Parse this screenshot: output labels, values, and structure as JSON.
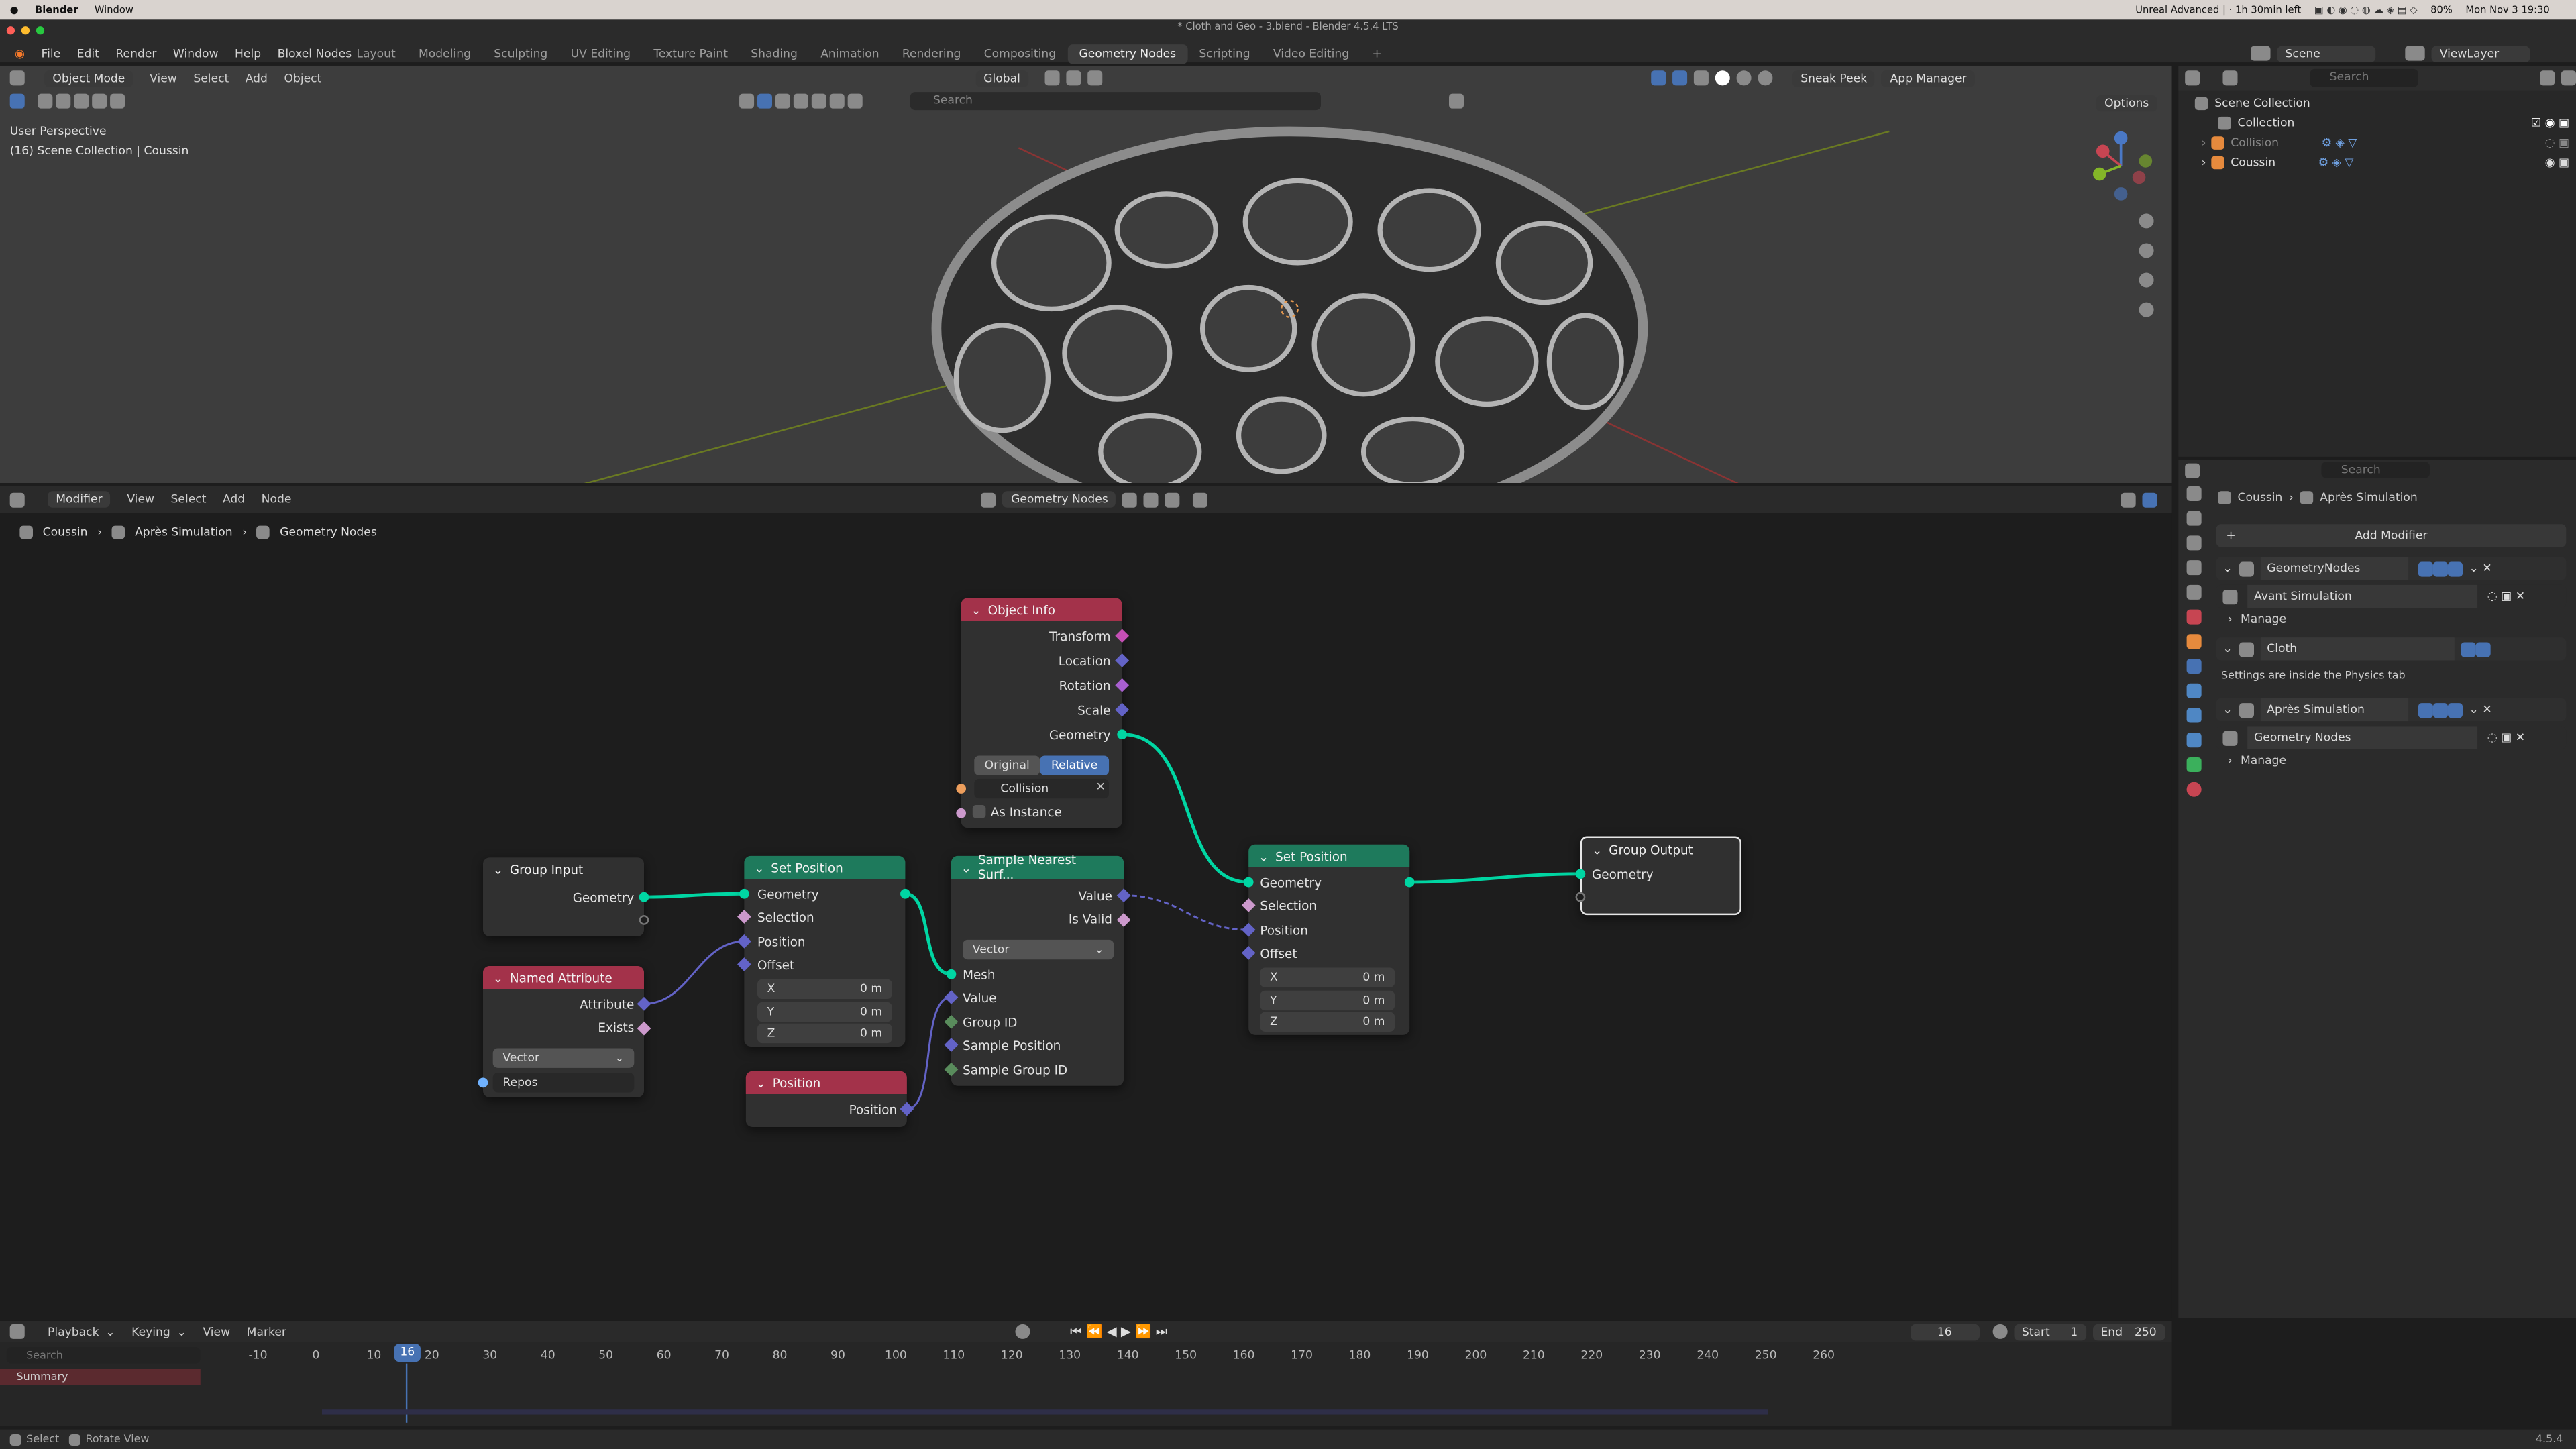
{
  "mac_menubar": {
    "app": "Blender",
    "window": "Window",
    "status": "Unreal Advanced | · 1h 30min left",
    "battery": "80%",
    "clock": "Mon Nov 3 19:30"
  },
  "window_title": "* Cloth and Geo - 3.blend - Blender 4.5.4 LTS",
  "menu": [
    "File",
    "Edit",
    "Render",
    "Window",
    "Help",
    "Bloxel Nodes"
  ],
  "workspaces": [
    "Layout",
    "Modeling",
    "Sculpting",
    "UV Editing",
    "Texture Paint",
    "Shading",
    "Animation",
    "Rendering",
    "Compositing",
    "Geometry Nodes",
    "Scripting",
    "Video Editing"
  ],
  "active_workspace": "Geometry Nodes",
  "viewport": {
    "mode": "Object Mode",
    "menus": [
      "View",
      "Select",
      "Add",
      "Object"
    ],
    "transform": "Global",
    "search_placeholder": "Search",
    "sneak_peek": "Sneak Peek",
    "app_manager": "App Manager",
    "options": "Options",
    "perspective": "User Perspective",
    "context": "(16) Scene Collection | Coussin"
  },
  "outliner": {
    "scene": "Scene",
    "view_layer": "ViewLayer",
    "search_placeholder": "Search",
    "root": "Scene Collection",
    "items": [
      "Collection",
      "Collision",
      "Coussin"
    ]
  },
  "node_editor": {
    "type": "Modifier",
    "menus": [
      "View",
      "Select",
      "Add",
      "Node"
    ],
    "tree_name": "Geometry Nodes",
    "breadcrumb": [
      "Coussin",
      "Après Simulation",
      "Geometry Nodes"
    ]
  },
  "nodes": {
    "object_info": {
      "title": "Object Info",
      "outputs": [
        "Transform",
        "Location",
        "Rotation",
        "Scale",
        "Geometry"
      ],
      "toggle": [
        "Original",
        "Relative"
      ],
      "object": "Collision",
      "as_instance": "As Instance"
    },
    "group_input": {
      "title": "Group Input",
      "outputs": [
        "Geometry"
      ]
    },
    "named_attr": {
      "title": "Named Attribute",
      "outputs": [
        "Attribute",
        "Exists"
      ],
      "type": "Vector",
      "name": "Repos"
    },
    "set_pos1": {
      "title": "Set Position",
      "inputs": [
        "Geometry",
        "Selection",
        "Position",
        "Offset"
      ],
      "xyz": [
        "X",
        "Y",
        "Z"
      ],
      "vals": [
        "0 m",
        "0 m",
        "0 m"
      ]
    },
    "position": {
      "title": "Position",
      "outputs": [
        "Position"
      ]
    },
    "sample": {
      "title": "Sample Nearest Surf...",
      "outputs": [
        "Value",
        "Is Valid"
      ],
      "type": "Vector",
      "inputs": [
        "Mesh",
        "Value",
        "Group ID",
        "Sample Position",
        "Sample Group ID"
      ]
    },
    "set_pos2": {
      "title": "Set Position",
      "inputs": [
        "Geometry",
        "Selection",
        "Position",
        "Offset"
      ],
      "xyz": [
        "X",
        "Y",
        "Z"
      ],
      "vals": [
        "0 m",
        "0 m",
        "0 m"
      ]
    },
    "group_output": {
      "title": "Group Output",
      "inputs": [
        "Geometry"
      ]
    }
  },
  "properties": {
    "search_placeholder": "Search",
    "object": "Coussin",
    "modifier": "Après Simulation",
    "add_modifier": "Add Modifier",
    "mods": [
      {
        "name": "GeometryNodes",
        "group": "Avant Simulation",
        "manage": "Manage"
      },
      {
        "name": "Cloth",
        "note": "Settings are inside the Physics tab"
      },
      {
        "name": "Après Simulation",
        "group": "Geometry Nodes",
        "manage": "Manage"
      }
    ]
  },
  "timeline": {
    "menus": [
      "Playback",
      "Keying",
      "View",
      "Marker"
    ],
    "current": "16",
    "start_label": "Start",
    "start": "1",
    "end_label": "End",
    "end": "250",
    "search_placeholder": "Search",
    "summary": "Summary",
    "ticks": [
      "-10",
      "0",
      "10",
      "20",
      "30",
      "40",
      "50",
      "60",
      "70",
      "80",
      "90",
      "100",
      "110",
      "120",
      "130",
      "140",
      "150",
      "160",
      "170",
      "180",
      "190",
      "200",
      "210",
      "220",
      "230",
      "240",
      "250",
      "260"
    ]
  },
  "statusbar": {
    "select": "Select",
    "rotate": "Rotate View",
    "version": "4.5.4"
  },
  "colors": {
    "accent": "#4772b3",
    "geo": "#00d6a3",
    "vector": "#6363c7",
    "obj_header": "#a3324a",
    "geo_header": "#1e7a5c",
    "attr_header": "#a3324a",
    "matrix": "#c54fb5"
  }
}
